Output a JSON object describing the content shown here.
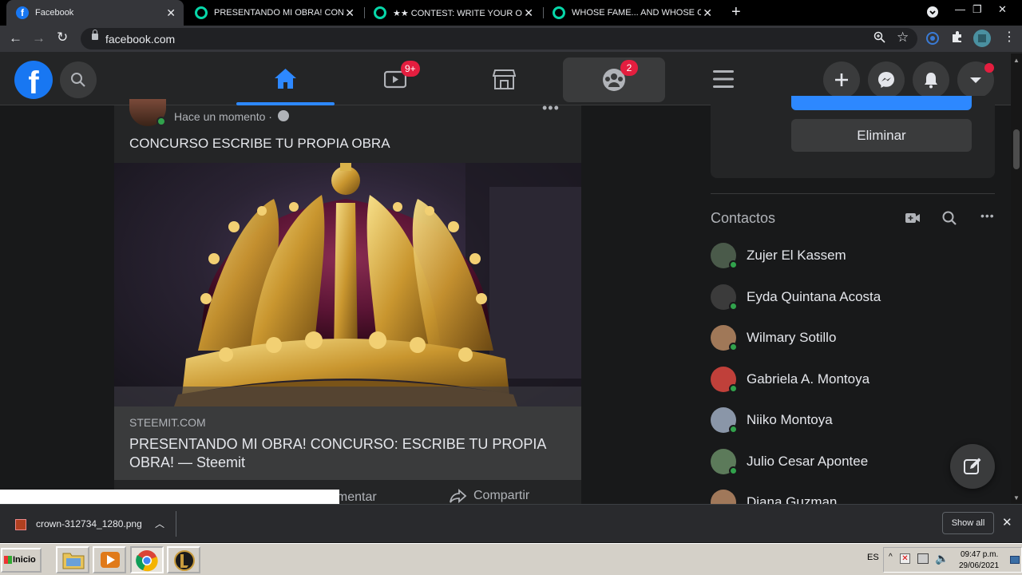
{
  "browser": {
    "tabs": [
      {
        "title": "Facebook",
        "favicon": "facebook-icon",
        "active": true
      },
      {
        "title": "PRESENTANDO MI OBRA! CONCURS",
        "favicon": "steemit-icon",
        "active": false
      },
      {
        "title": "★★ CONTEST: WRITE YOUR OWN P",
        "favicon": "steemit-icon",
        "active": false
      },
      {
        "title": "WHOSE FAME... AND WHOSE COST",
        "favicon": "steemit-icon",
        "active": false
      }
    ],
    "url": "facebook.com"
  },
  "fb_header": {
    "watch_badge": "9+",
    "groups_badge": "2",
    "accent": "#2d88ff"
  },
  "post": {
    "time": "Hace un momento ·",
    "text": "CONCURSO ESCRIBE TU PROPIA OBRA",
    "link_domain": "STEEMIT.COM",
    "link_title": "PRESENTANDO MI OBRA! CONCURSO: ESCRIBE TU PROPIA OBRA! — Steemit",
    "comment_label": "omentar",
    "share_label": "Compartir"
  },
  "right": {
    "delete_label": "Eliminar",
    "contacts_title": "Contactos",
    "contacts": [
      {
        "name": "Zujer El Kassem",
        "color": "#4a5a4a"
      },
      {
        "name": "Eyda Quintana Acosta",
        "color": "#3b3b3b"
      },
      {
        "name": "Wilmary Sotillo",
        "color": "#a07858"
      },
      {
        "name": "Gabriela A. Montoya",
        "color": "#c0403a"
      },
      {
        "name": "Niiko Montoya",
        "color": "#8a96a8"
      },
      {
        "name": "Julio Cesar Apontee",
        "color": "#5c7a5a"
      },
      {
        "name": "Diana Guzman",
        "color": "#a0785a"
      }
    ]
  },
  "downloads": {
    "file_name": "crown-312734_1280.png",
    "show_all": "Show all"
  },
  "taskbar": {
    "start_label": "Inicio",
    "lang": "ES",
    "time": "09:47 p.m.",
    "date": "29/06/2021"
  }
}
